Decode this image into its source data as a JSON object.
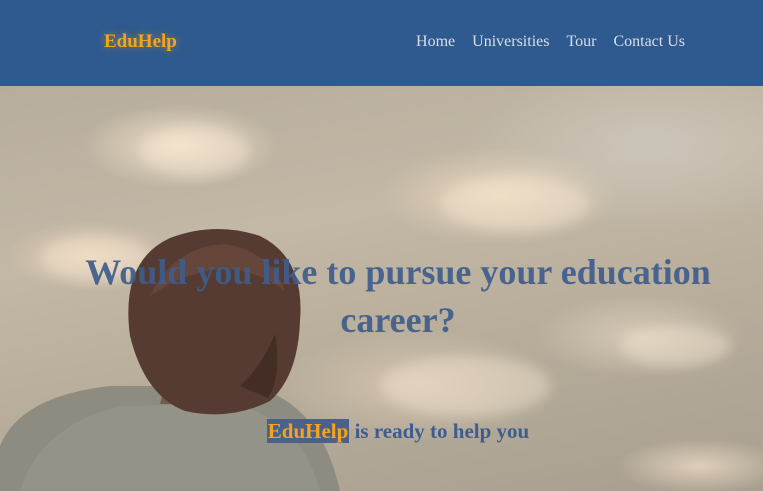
{
  "navbar": {
    "brand": "EduHelp",
    "links": [
      {
        "label": "Home"
      },
      {
        "label": "Universities"
      },
      {
        "label": "Tour"
      },
      {
        "label": "Contact Us"
      }
    ]
  },
  "hero": {
    "heading": "Would you like to pursue your education career?",
    "tagline_brand": "EduHelp",
    "tagline_rest": " is ready to help you"
  },
  "colors": {
    "navbar_bg": "#2f5a8f",
    "brand_orange": "#f6a31d",
    "heading_blue": "#3f5d8c"
  }
}
